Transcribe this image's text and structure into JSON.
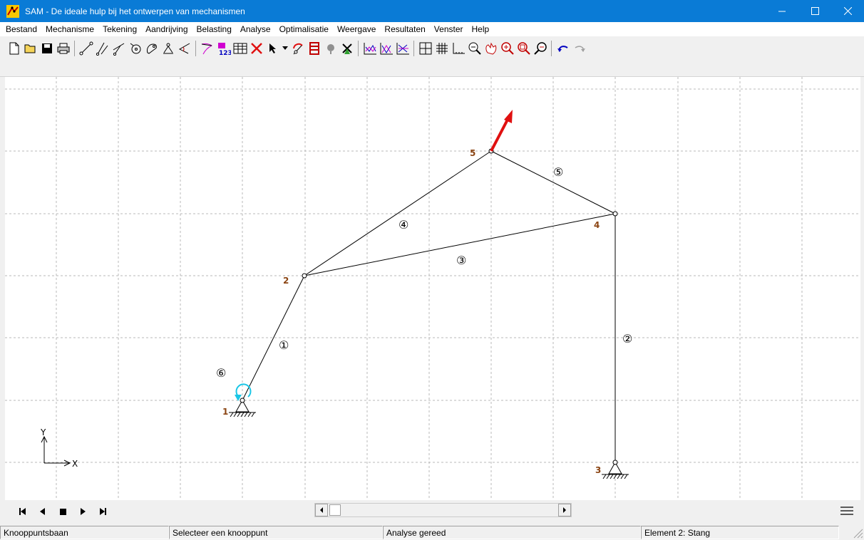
{
  "window": {
    "title": "SAM - De ideale hulp bij het ontwerpen van mechanismen",
    "accent_color": "#0a7bd6"
  },
  "menu": [
    "Bestand",
    "Mechanisme",
    "Tekening",
    "Aandrijving",
    "Belasting",
    "Analyse",
    "Optimalisatie",
    "Weergave",
    "Resultaten",
    "Venster",
    "Help"
  ],
  "toolbar_icons": [
    "new-file-icon",
    "open-folder-icon",
    "save-icon",
    "print-icon",
    "beam-element-icon",
    "slider-element-icon",
    "pin-slider-icon",
    "gear-icon",
    "cam-icon",
    "spring-icon",
    "angle-icon",
    "curve-icon",
    "numbering-icon",
    "table-icon",
    "delete-icon",
    "pointer-icon",
    "dropdown-icon",
    "drive-icon",
    "load-icon",
    "mass-icon",
    "windmill-icon",
    "graph-1-icon",
    "graph-2-icon",
    "graph-3-icon",
    "grid-toggle-icon",
    "grid-icon",
    "axes-icon",
    "zoom-out-icon",
    "pan-icon",
    "zoom-in-icon",
    "zoom-window-icon",
    "zoom-fit-icon",
    "undo-icon",
    "redo-icon"
  ],
  "mechanism": {
    "nodes": [
      {
        "id": "1",
        "label": "1"
      },
      {
        "id": "2",
        "label": "2"
      },
      {
        "id": "3",
        "label": "3"
      },
      {
        "id": "4",
        "label": "4"
      },
      {
        "id": "5",
        "label": "5"
      }
    ],
    "elements": [
      {
        "id": "1",
        "label": "①"
      },
      {
        "id": "2",
        "label": "②"
      },
      {
        "id": "3",
        "label": "③"
      },
      {
        "id": "4",
        "label": "④"
      },
      {
        "id": "5",
        "label": "⑤"
      },
      {
        "id": "6",
        "label": "⑥"
      }
    ],
    "axis_labels": {
      "x": "X",
      "y": "Y"
    },
    "colors": {
      "link": "#000000",
      "node_label": "#8b4513",
      "load": "#e01010",
      "drive": "#1ac6e6"
    }
  },
  "navigation": {
    "buttons": [
      "first-frame-icon",
      "prev-frame-icon",
      "stop-icon",
      "next-frame-icon",
      "last-frame-icon"
    ]
  },
  "status": {
    "cells": [
      "Knooppuntsbaan",
      "Selecteer een knooppunt",
      "Analyse gereed",
      "Element 2: Stang"
    ]
  }
}
